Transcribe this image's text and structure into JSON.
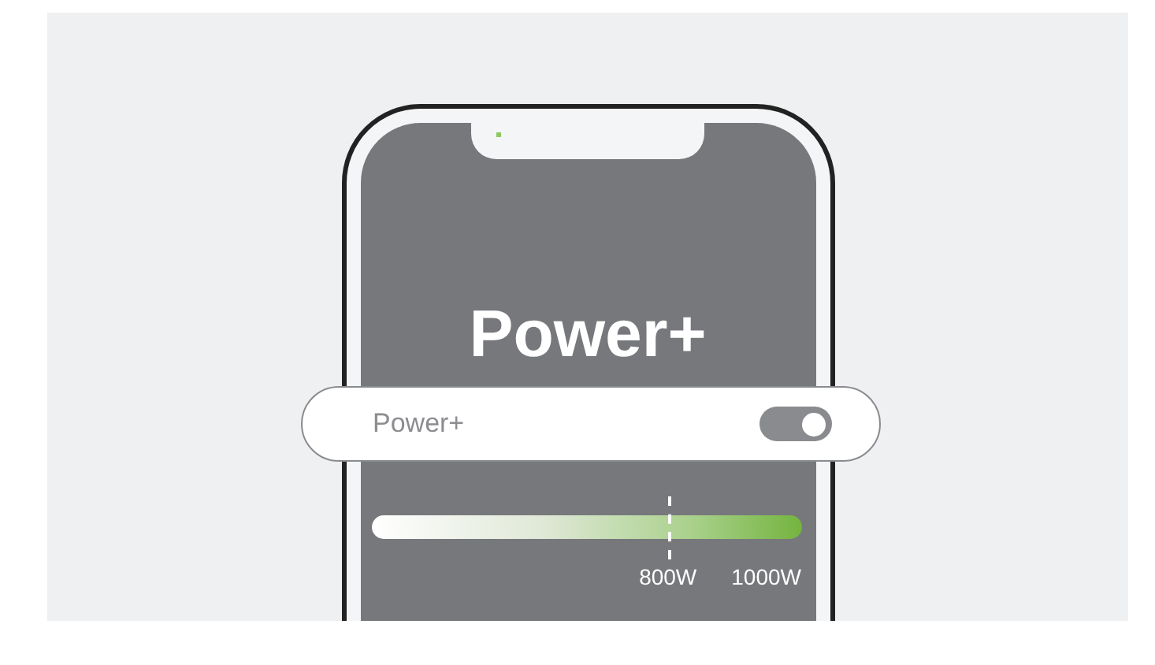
{
  "title": "Power+",
  "setting": {
    "label": "Power+",
    "on": true
  },
  "power_bar": {
    "level": 0.69,
    "marker_label": "800W",
    "max_label": "1000W"
  }
}
